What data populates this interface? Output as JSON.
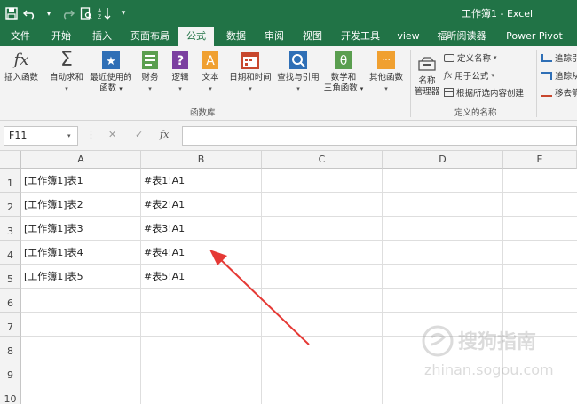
{
  "window": {
    "title": "工作簿1  -  Excel"
  },
  "tabs": [
    {
      "label": "文件"
    },
    {
      "label": "开始"
    },
    {
      "label": "插入"
    },
    {
      "label": "页面布局"
    },
    {
      "label": "公式"
    },
    {
      "label": "数据"
    },
    {
      "label": "审阅"
    },
    {
      "label": "视图"
    },
    {
      "label": "开发工具"
    },
    {
      "label": "view"
    },
    {
      "label": "福昕阅读器"
    },
    {
      "label": "Power Pivot"
    }
  ],
  "active_tab": "公式",
  "ribbon": {
    "insert_function": "插入函数",
    "autosum": "自动求和",
    "recent_line1": "最近使用的",
    "recent_line2": "函数",
    "financial": "财务",
    "logical": "逻辑",
    "text": "文本",
    "datetime": "日期和时间",
    "lookup": "查找与引用",
    "math_line1": "数学和",
    "math_line2": "三角函数",
    "other": "其他函数",
    "library_label": "函数库",
    "name_manager_line1": "名称",
    "name_manager_line2": "管理器",
    "define_name": "定义名称",
    "use_in_formula": "用于公式",
    "create_from_selection": "根据所选内容创建",
    "defined_names_label": "定义的名称",
    "trace_precedents": "追踪引",
    "trace_dependents": "追踪从",
    "remove_arrows": "移去箭"
  },
  "icons": {
    "fx": "fx",
    "sigma": "Σ",
    "star": "★",
    "question": "?",
    "text_a": "A",
    "theta": "θ",
    "dots": "···",
    "cancel": "✕",
    "enter": "✓",
    "dropdown": "▾",
    "menu_dot": "⋮"
  },
  "formula_bar": {
    "name_box": "F11",
    "fx_label": "fx",
    "formula": ""
  },
  "columns": [
    "A",
    "B",
    "C",
    "D",
    "E"
  ],
  "rows": [
    "1",
    "2",
    "3",
    "4",
    "5",
    "6",
    "7",
    "8",
    "9",
    "10"
  ],
  "cells": {
    "A": [
      "[工作簿1]表1",
      "[工作簿1]表2",
      "[工作簿1]表3",
      "[工作簿1]表4",
      "[工作簿1]表5"
    ],
    "B": [
      "#表1!A1",
      "#表2!A1",
      "#表3!A1",
      "#表4!A1",
      "#表5!A1"
    ]
  },
  "watermark": {
    "line1": "搜狗指南",
    "line2": "zhinan.sogou.com"
  },
  "colors": {
    "excel_green": "#217346",
    "arrow_red": "#e53935"
  }
}
